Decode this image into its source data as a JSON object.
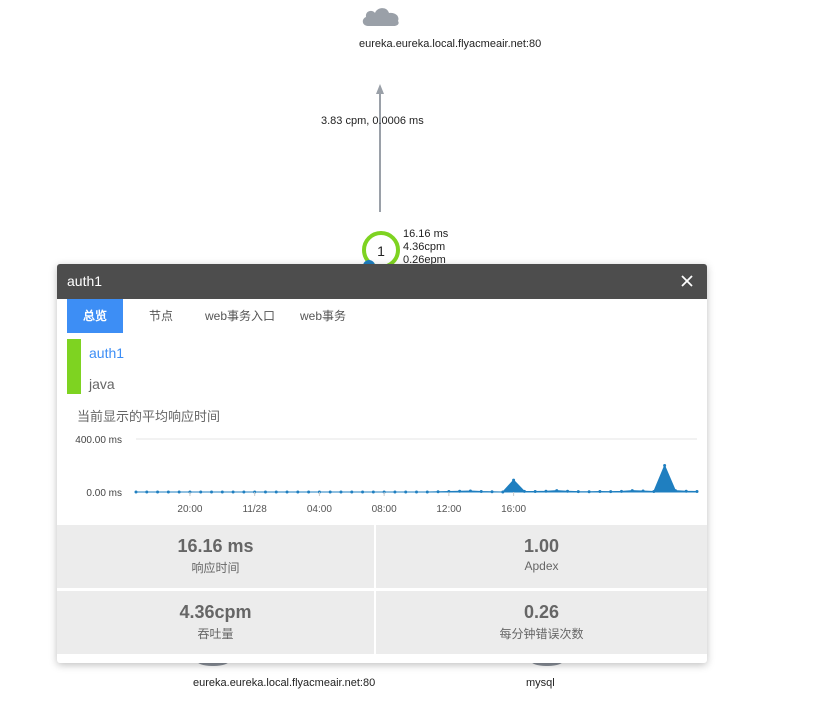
{
  "topology": {
    "top_host": "eureka.eureka.local.flyacmeair.net:80",
    "edge_label": "3.83 cpm, 0.0006 ms",
    "node_count": "1",
    "node_ms": "16.16 ms",
    "node_cpm": "4.36cpm",
    "node_epm": "0.26epm",
    "bottom_host_1": "eureka.eureka.local.flyacmeair.net:80",
    "bottom_host_2": "mysql"
  },
  "panel": {
    "title": "auth1",
    "tabs": [
      "总览",
      "节点",
      "web事务入口",
      "web事务"
    ],
    "app_name": "auth1",
    "app_lang": "java",
    "chart_heading": "当前显示的平均响应时间"
  },
  "chart_data": {
    "type": "area",
    "title": "当前显示的平均响应时间",
    "y_tick_labels": [
      "400.00 ms",
      "0.00 ms"
    ],
    "ylim": [
      0,
      400
    ],
    "x_tick_labels": [
      "20:00",
      "11/28",
      "04:00",
      "08:00",
      "12:00",
      "16:00"
    ],
    "x_tick_positions": [
      5,
      11,
      17,
      23,
      29,
      35
    ],
    "series": [
      {
        "values": [
          0,
          0,
          0,
          0,
          0,
          0,
          0,
          0,
          0,
          0,
          0,
          0,
          0,
          0,
          0,
          0,
          0,
          0,
          0,
          0,
          0,
          0,
          0,
          0,
          0,
          0,
          0,
          0,
          2,
          4,
          6,
          8,
          4,
          2,
          0,
          90,
          5,
          4,
          6,
          10,
          6,
          3,
          2,
          4,
          3,
          5,
          10,
          8,
          4,
          200,
          10,
          6,
          4
        ]
      }
    ],
    "color": "#1f7fc0",
    "grid": true
  },
  "stats": {
    "response_value": "16.16 ms",
    "response_label": "响应时间",
    "apdex_value": "1.00",
    "apdex_label": "Apdex",
    "throughput_value": "4.36cpm",
    "throughput_label": "吞吐量",
    "errors_value": "0.26",
    "errors_label": "每分钟错误次数"
  },
  "colors": {
    "accent": "#3d8ef5",
    "node_ring": "#7ed321",
    "header": "#4d4d4d"
  }
}
